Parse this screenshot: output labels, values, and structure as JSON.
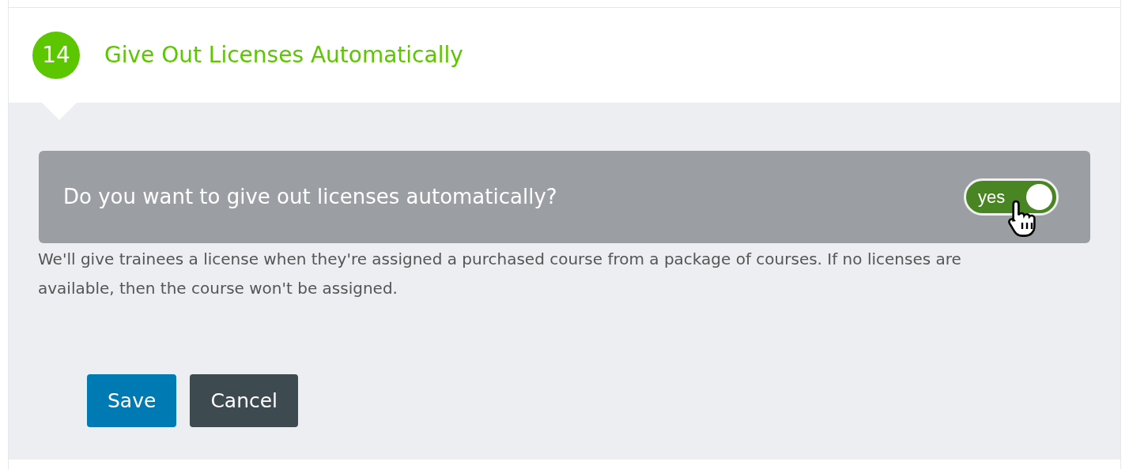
{
  "step": {
    "number": "14",
    "title": "Give Out Licenses Automatically"
  },
  "question": {
    "text": "Do you want to give out licenses automatically?",
    "toggle": {
      "label": "yes",
      "on": true
    }
  },
  "description": "We'll give trainees a license when they're assigned a purchased course from a package of courses. If no licenses are available, then the course won't be assigned.",
  "buttons": [
    {
      "label": "Save",
      "kind": "primary"
    },
    {
      "label": "Cancel",
      "kind": "secondary"
    }
  ]
}
